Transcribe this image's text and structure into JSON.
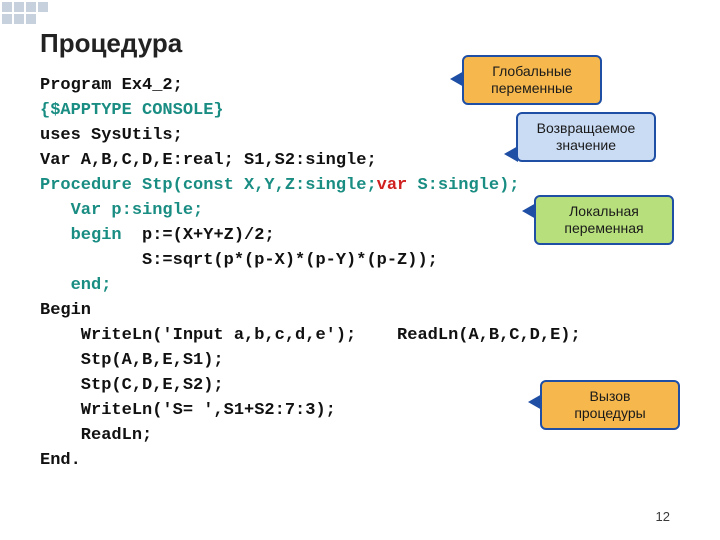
{
  "title": "Процедура",
  "code": {
    "l1": "Program Ex4_2;",
    "l2": "{$APPTYPE CONSOLE}",
    "l3": "uses SysUtils;",
    "l4": "Var A,B,C,D,E:real; S1,S2:single;",
    "l5a": "Procedure Stp(const X,Y,Z:single;",
    "l5b": "var",
    "l5c": " S:single);",
    "l6": "   Var p:single;",
    "l7a": "   begin",
    "l7b": "  p:=(X+Y+Z)/2;",
    "l8": "          S:=sqrt(p*(p-X)*(p-Y)*(p-Z));",
    "l9": "   end;",
    "l10": "Begin",
    "l11": "    WriteLn('Input a,b,c,d,e');    ReadLn(A,B,C,D,E);",
    "l12": "    Stp(A,B,E,S1);",
    "l13": "    Stp(C,D,E,S2);",
    "l14": "    WriteLn('S= ',S1+S2:7:3);",
    "l15": "    ReadLn;",
    "l16": "End."
  },
  "callouts": {
    "global": "Глобальные переменные",
    "return": "Возвращаемое значение",
    "local": "Локальная переменная",
    "call": "Вызов процедуры"
  },
  "page": "12"
}
